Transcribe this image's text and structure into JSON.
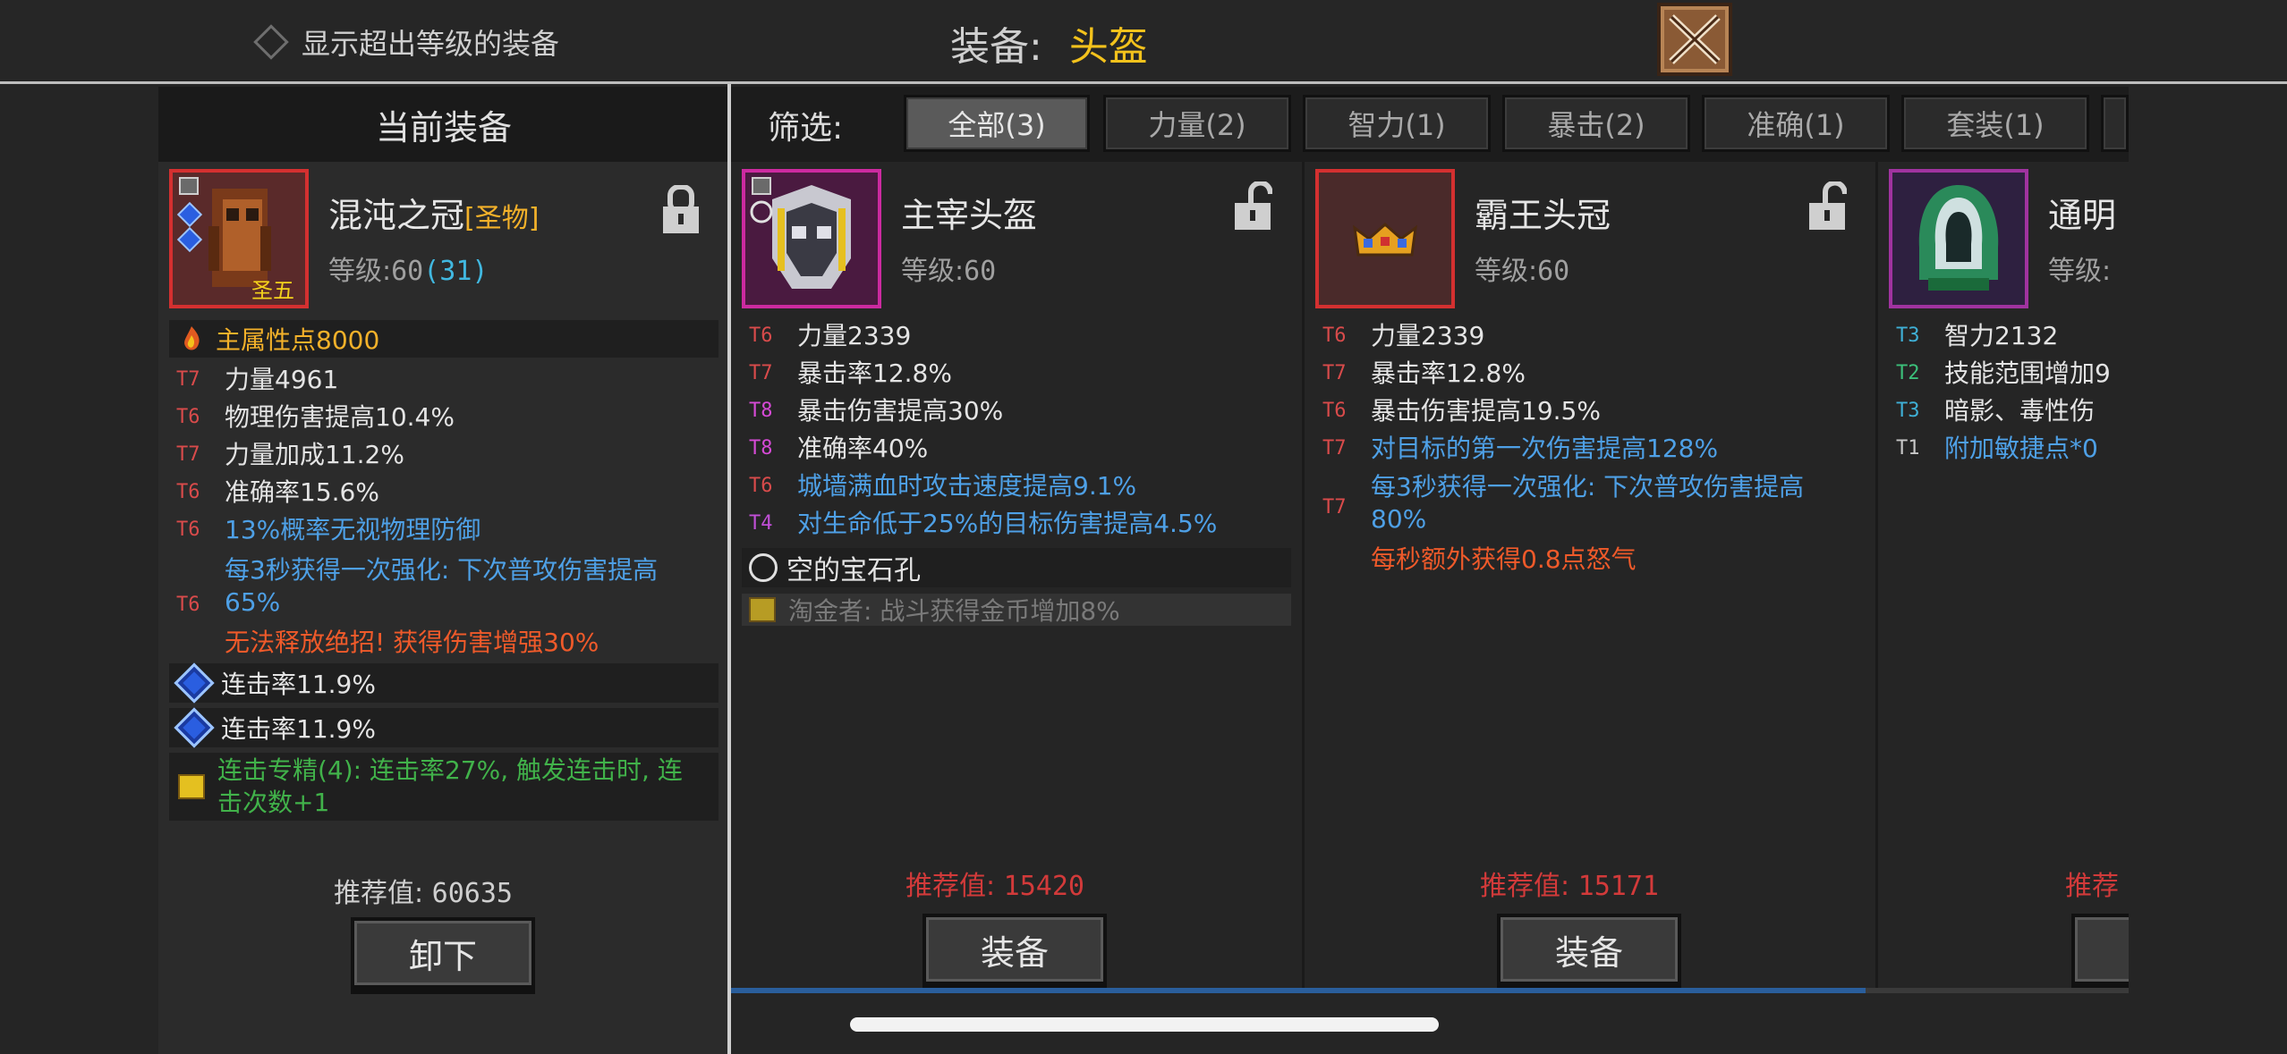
{
  "header": {
    "filter_toggle_label": "显示超出等级的装备",
    "title_label": "装备:",
    "title_value": "头盔"
  },
  "current": {
    "panel_title": "当前装备",
    "name": "混沌之冠",
    "rarity_tag": "[圣物]",
    "level_label": "等级:",
    "level": "60",
    "level_extra": "(31)",
    "icon_badge": "圣五",
    "main_attr": "主属性点8000",
    "stats": [
      {
        "tier": "T7",
        "text": "力量4961",
        "style": "white"
      },
      {
        "tier": "T6",
        "text": "物理伤害提高10.4%",
        "style": "white"
      },
      {
        "tier": "T7",
        "text": "力量加成11.2%",
        "style": "white"
      },
      {
        "tier": "T6",
        "text": "准确率15.6%",
        "style": "white"
      },
      {
        "tier": "T6",
        "text": "13%概率无视物理防御",
        "style": "blue"
      }
    ],
    "special_tier": "T6",
    "special_text": "每3秒获得一次强化: 下次普攻伤害提高65%",
    "special_penalty": "无法释放绝招! 获得伤害增强30%",
    "gems": [
      "连击率11.9%",
      "连击率11.9%"
    ],
    "set_bonus": "连击专精(4): 连击率27%, 触发连击时, 连击次数+1",
    "recommend_label": "推荐值:",
    "recommend_value": "60635",
    "action_label": "卸下"
  },
  "filter": {
    "label": "筛选:",
    "tabs": [
      "全部(3)",
      "力量(2)",
      "智力(1)",
      "暴击(2)",
      "准确(1)",
      "套装(1)"
    ]
  },
  "items": [
    {
      "name": "主宰头盔",
      "level_label": "等级:",
      "level": "60",
      "stats": [
        {
          "tier": "T6",
          "text": "力量2339",
          "style": "white"
        },
        {
          "tier": "T7",
          "text": "暴击率12.8%",
          "style": "white"
        },
        {
          "tier": "T8",
          "text": "暴击伤害提高30%",
          "style": "white"
        },
        {
          "tier": "T8",
          "text": "准确率40%",
          "style": "white"
        },
        {
          "tier": "T6",
          "text": "城墙满血时攻击速度提高9.1%",
          "style": "blue"
        },
        {
          "tier": "T4",
          "text": "对生命低于25%的目标伤害提高4.5%",
          "style": "blue"
        }
      ],
      "socket": "空的宝石孔",
      "set_text": "淘金者: 战斗获得金币增加8%",
      "recommend_label": "推荐值:",
      "recommend_value": "15420",
      "action_label": "装备"
    },
    {
      "name": "霸王头冠",
      "level_label": "等级:",
      "level": "60",
      "stats": [
        {
          "tier": "T6",
          "text": "力量2339",
          "style": "white"
        },
        {
          "tier": "T7",
          "text": "暴击率12.8%",
          "style": "white"
        },
        {
          "tier": "T6",
          "text": "暴击伤害提高19.5%",
          "style": "white"
        },
        {
          "tier": "T7",
          "text": "对目标的第一次伤害提高128%",
          "style": "blue"
        }
      ],
      "special_tier": "T7",
      "special_text": "每3秒获得一次强化: 下次普攻伤害提高80%",
      "special_extra": "每秒额外获得0.8点怒气",
      "recommend_label": "推荐值:",
      "recommend_value": "15171",
      "action_label": "装备"
    },
    {
      "name": "通明",
      "level_label": "等级:",
      "stats": [
        {
          "tier": "T3",
          "text": "智力2132",
          "style": "white"
        },
        {
          "tier": "T2",
          "text": "技能范围增加9",
          "style": "white"
        },
        {
          "tier": "T3",
          "text": "暗影、毒性伤",
          "style": "white"
        },
        {
          "tier": "T1",
          "text": "附加敏捷点*0",
          "style": "blue"
        }
      ],
      "recommend_label": "推荐"
    }
  ],
  "icons": {
    "close": "close-x-icon",
    "lock": "lock-icon",
    "unlock": "unlock-icon",
    "gem": "blue-gem-icon",
    "book": "set-book-icon",
    "main_attr": "flame-icon"
  },
  "colors": {
    "title_value": "#f3c21c",
    "rarity": "#f3b12a",
    "recommend": "#d23a3a",
    "special_blue": "#4ea0e6",
    "penalty": "#ef5a2a",
    "set_green": "#41b24a"
  }
}
